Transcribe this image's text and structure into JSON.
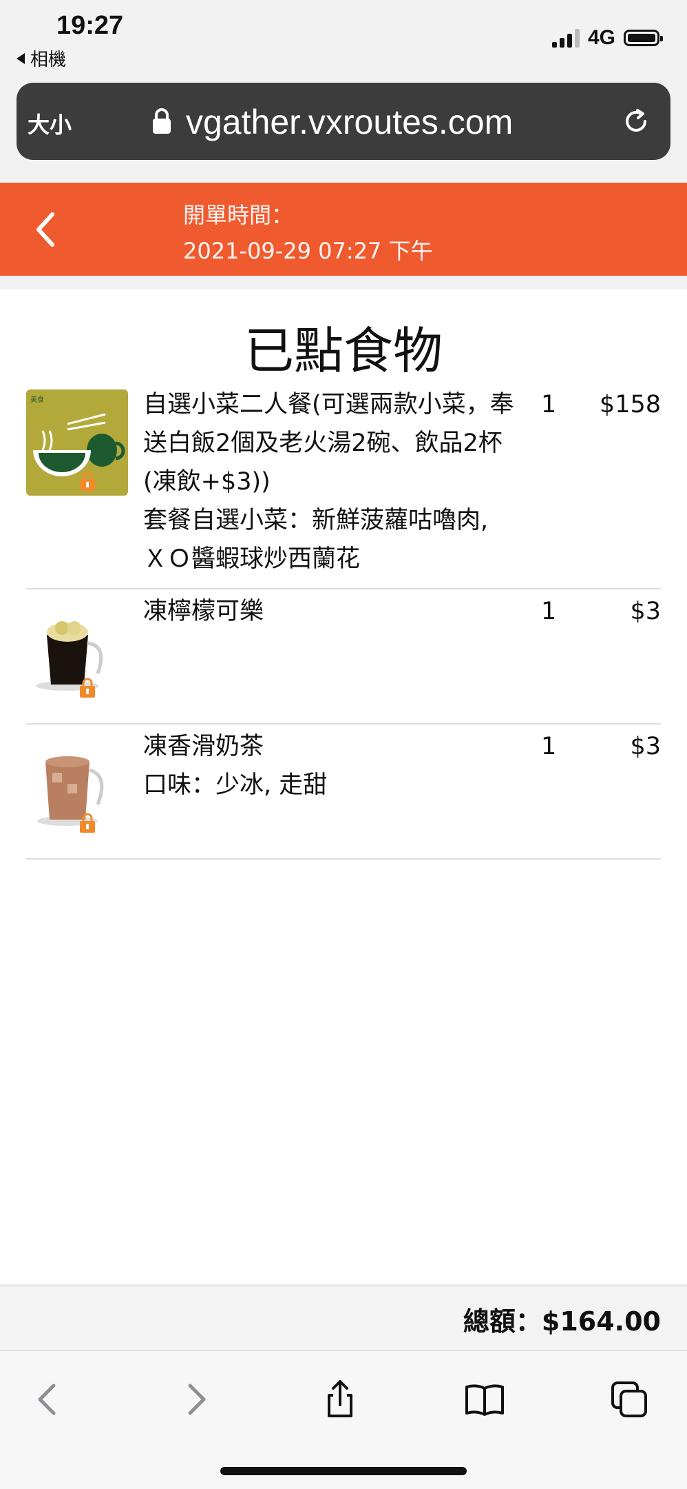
{
  "status_bar": {
    "time": "19:27",
    "back_app": "相機",
    "network": "4G"
  },
  "browser": {
    "text_size": "大小",
    "url": "vgather.vxroutes.com"
  },
  "header": {
    "label": "開單時間：",
    "time": "2021-09-29 07:27 下午"
  },
  "page": {
    "title": "已點食物"
  },
  "items": [
    {
      "name": "自選小菜二人餐(可選兩款小菜，奉送白飯2個及老火湯2碗、飲品2杯(凍飲+$3))",
      "option": "套餐自選小菜：新鮮菠蘿咕嚕肉, ＸＯ醬蝦球炒西蘭花",
      "qty": "1",
      "price": "$158",
      "image": "bowl-and-cup-logo"
    },
    {
      "name": "凍檸檬可樂",
      "option": "",
      "qty": "1",
      "price": "$3",
      "image": "iced-lemon-cola-glass"
    },
    {
      "name": "凍香滑奶茶",
      "option": "口味：少冰, 走甜",
      "qty": "1",
      "price": "$3",
      "image": "iced-milk-tea-glass"
    }
  ],
  "footer": {
    "total": "總額：$164.00"
  },
  "toolbar": {
    "icons": [
      "back-icon",
      "forward-icon",
      "share-icon",
      "bookmarks-icon",
      "tabs-icon"
    ]
  },
  "colors": {
    "accent": "#f05a2f",
    "url_bar": "#3c3c3c"
  }
}
